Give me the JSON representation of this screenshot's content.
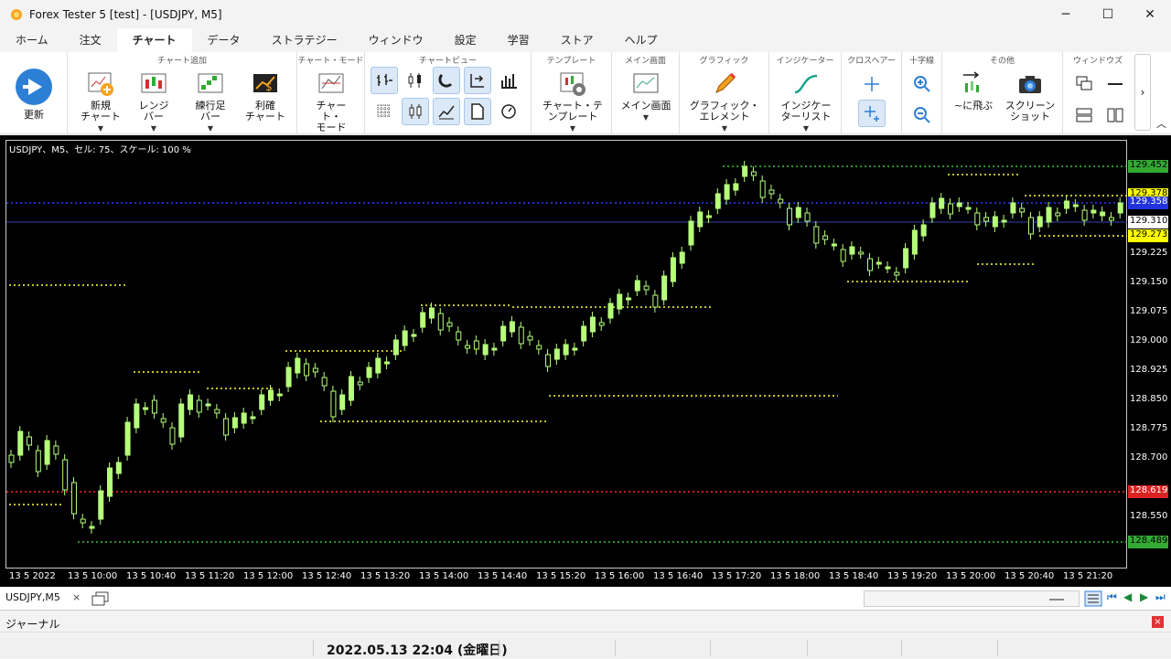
{
  "window": {
    "title": "Forex Tester 5  [test] - [USDJPY, M5]",
    "minimize": "─",
    "maximize": "☐",
    "close": "✕"
  },
  "menu_tabs": [
    "ホーム",
    "注文",
    "チャート",
    "データ",
    "ストラテジー",
    "ウィンドウ",
    "設定",
    "学習",
    "ストア",
    "ヘルプ"
  ],
  "active_tab": "チャート",
  "ribbon": {
    "update": "更新",
    "chart_add_title": "チャート追加",
    "new_chart": "新規\nチャート",
    "range_bar": "レンジ\nバー",
    "renko_bar": "練行足\nバー",
    "profit_chart": "利確\nチャート",
    "chart_mode_title": "チャート・モード",
    "chart_mode": "チャート・\nモード",
    "chart_view_title": "チャートビュー",
    "template_title": "テンプレート",
    "chart_template": "チャート・テ\nンプレート",
    "main_screen_title": "メイン画面",
    "main_screen": "メイン画面",
    "graphic_title": "グラフィック",
    "graphic_element": "グラフィック・\nエレメント",
    "indicator_title": "インジケーター",
    "indicator_list": "インジケー\nターリスト",
    "crosshair_title": "クロスヘアー",
    "cross_title": "十字線",
    "other_title": "その他",
    "jump_to": "~に飛ぶ",
    "screenshot": "スクリーン\nショット",
    "windows_title": "ウィンドウズ"
  },
  "chart": {
    "info": "USDJPY、M5、セル: 75、スケール: 100 %",
    "price_labels": [
      "129.225",
      "129.150",
      "129.075",
      "129.000",
      "128.925",
      "128.850",
      "128.775",
      "128.700",
      "128.550",
      "128.475"
    ],
    "badges": [
      {
        "text": "129.452",
        "bg": "#33aa33",
        "fg": "#000000"
      },
      {
        "text": "129.378",
        "bg": "#ffff00",
        "fg": "#000000"
      },
      {
        "text": "129.358",
        "bg": "#2233dd",
        "fg": "#ffffff"
      },
      {
        "text": "129.310",
        "bg": "#ffffff",
        "fg": "#000000"
      },
      {
        "text": "129.273",
        "bg": "#ffff00",
        "fg": "#000000"
      },
      {
        "text": "128.619",
        "bg": "#dd2222",
        "fg": "#ffffff"
      },
      {
        "text": "128.489",
        "bg": "#33aa33",
        "fg": "#000000"
      }
    ],
    "time_labels": [
      "13 5 2022",
      "13 5 10:00",
      "13 5 10:40",
      "13 5 11:20",
      "13 5 12:00",
      "13 5 12:40",
      "13 5 13:20",
      "13 5 14:00",
      "13 5 14:40",
      "13 5 15:20",
      "13 5 16:00",
      "13 5 16:40",
      "13 5 17:20",
      "13 5 18:00",
      "13 5 18:40",
      "13 5 19:20",
      "13 5 20:00",
      "13 5 20:40",
      "13 5 21:20"
    ],
    "colors": {
      "candle": "#b6ff7a",
      "level": "#ffff33",
      "blue_line": "#2c3cff",
      "red_line": "#ff2a2a",
      "green_line": "#3bbf3b"
    }
  },
  "bottom": {
    "chart_tab": "USDJPY,M5",
    "tab_close": "×",
    "journal": "ジャーナル",
    "journal_close": "×",
    "status_date": "2022.05.13 22:04 (金曜日)"
  }
}
